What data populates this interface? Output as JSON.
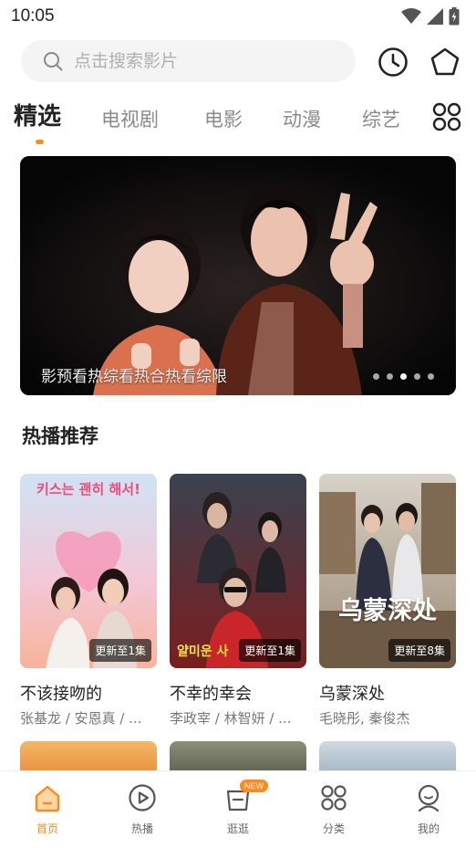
{
  "status_bar": {
    "time": "10:05",
    "icons": [
      "wifi-icon",
      "signal-icon",
      "battery-icon"
    ]
  },
  "search": {
    "placeholder": "点击搜索影片",
    "history_icon": "clock-icon",
    "skin_icon": "pentagon-icon"
  },
  "tabs": [
    {
      "label": "精选",
      "active": true
    },
    {
      "label": "电视剧",
      "active": false
    },
    {
      "label": "电影",
      "active": false
    },
    {
      "label": "动漫",
      "active": false
    },
    {
      "label": "综艺",
      "active": false
    }
  ],
  "tab_more_icon": "grid-icon",
  "banner": {
    "caption": "影预看热综看热合热看综限",
    "dot_count": 5,
    "active_dot": 2
  },
  "section": {
    "title": "热播推荐"
  },
  "cards": [
    {
      "title": "不该接吻的",
      "subtitle": "张基龙 / 安恩真 / ...",
      "badge": "更新至1集",
      "poster_text": "키스는 괜히 해서!"
    },
    {
      "title": "不幸的幸会",
      "subtitle": "李政宰 / 林智妍 / ...",
      "badge": "更新至1集",
      "poster_text": "얄미운 사"
    },
    {
      "title": "乌蒙深处",
      "subtitle": "毛晓彤, 秦俊杰",
      "badge": "更新至8集",
      "poster_text": "乌蒙深处"
    }
  ],
  "bottom_nav": [
    {
      "label": "首页",
      "icon": "home-icon",
      "active": true
    },
    {
      "label": "热播",
      "icon": "play-circle-icon",
      "active": false
    },
    {
      "label": "逛逛",
      "icon": "shopping-bag-icon",
      "active": false,
      "badge": "NEW"
    },
    {
      "label": "分类",
      "icon": "category-grid-icon",
      "active": false
    },
    {
      "label": "我的",
      "icon": "profile-icon",
      "active": false
    }
  ],
  "colors": {
    "accent": "#ff8a1c",
    "tab_inactive": "#8a8a8a",
    "search_bg": "#f4f4f4"
  }
}
